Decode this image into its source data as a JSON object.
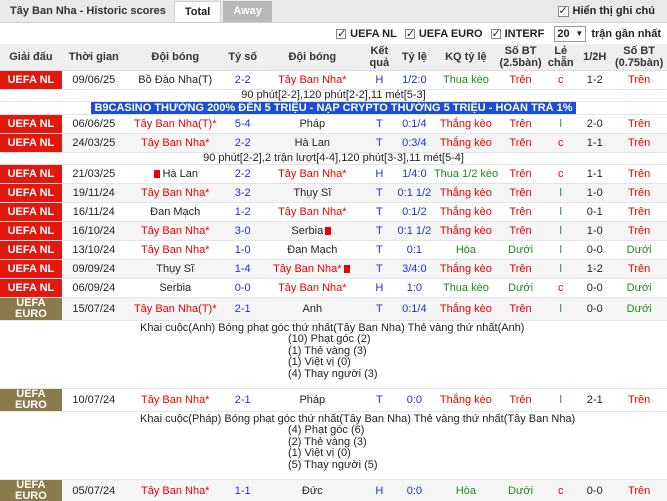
{
  "header": {
    "title": "Tây Ban Nha - Historic scores",
    "tabs": [
      "Total",
      "Away"
    ],
    "show_notes_label": "Hiển thị ghi chú"
  },
  "filters": {
    "items": [
      "UEFA NL",
      "UEFA EURO",
      "INTERF"
    ],
    "count_value": "20",
    "count_suffix": "trận gần nhất"
  },
  "columns": [
    "Giải đấu",
    "Thời gian",
    "Đội bóng",
    "Tỷ số",
    "Đội bóng",
    "Kết quả",
    "Tỷ lệ",
    "KQ tỷ lệ",
    "Số BT (2.5bàn)",
    "Lẻ chẵn",
    "1/2H",
    "Số BT (0.75bàn)"
  ],
  "rows": [
    {
      "league": "UEFA NL",
      "date": "09/06/25",
      "home": "Bồ Đào Nha(T)",
      "score": "2-2",
      "away": "Tây Ban Nha*",
      "res": "H",
      "odds": "1/2:0",
      "kq": "Thua kèo",
      "bt": "Trên",
      "lc": "c",
      "half": "1-2",
      "bt2": "Trên"
    },
    {
      "league": "UEFA NL",
      "date": "06/06/25",
      "home": "Tây Ban Nha(T)*",
      "score": "5-4",
      "away": "Pháp",
      "res": "T",
      "odds": "0:1/4",
      "kq": "Thắng kèo",
      "bt": "Trên",
      "lc": "l",
      "half": "2-0",
      "bt2": "Trên"
    },
    {
      "league": "UEFA NL",
      "date": "24/03/25",
      "home": "Tây Ban Nha*",
      "score": "2-2",
      "away": "Hà Lan",
      "res": "T",
      "odds": "0:3/4",
      "kq": "Thắng kèo",
      "bt": "Trên",
      "lc": "c",
      "half": "1-1",
      "bt2": "Trên"
    },
    {
      "league": "UEFA NL",
      "date": "21/03/25",
      "home": "Hà Lan",
      "score": "2-2",
      "away": "Tây Ban Nha*",
      "res": "H",
      "odds": "1/4:0",
      "kq": "Thua 1/2 kèo",
      "bt": "Trên",
      "lc": "c",
      "half": "1-1",
      "bt2": "Trên"
    },
    {
      "league": "UEFA NL",
      "date": "19/11/24",
      "home": "Tây Ban Nha*",
      "score": "3-2",
      "away": "Thụy Sĩ",
      "res": "T",
      "odds": "0:1 1/2",
      "kq": "Thắng kèo",
      "bt": "Trên",
      "lc": "l",
      "half": "1-0",
      "bt2": "Trên"
    },
    {
      "league": "UEFA NL",
      "date": "16/11/24",
      "home": "Đan Mạch",
      "score": "1-2",
      "away": "Tây Ban Nha*",
      "res": "T",
      "odds": "0:1/2",
      "kq": "Thắng kèo",
      "bt": "Trên",
      "lc": "l",
      "half": "0-1",
      "bt2": "Trên"
    },
    {
      "league": "UEFA NL",
      "date": "16/10/24",
      "home": "Tây Ban Nha*",
      "score": "3-0",
      "away": "Serbia",
      "res": "T",
      "odds": "0:1 1/2",
      "kq": "Thắng kèo",
      "bt": "Trên",
      "lc": "l",
      "half": "1-0",
      "bt2": "Trên"
    },
    {
      "league": "UEFA NL",
      "date": "13/10/24",
      "home": "Tây Ban Nha*",
      "score": "1-0",
      "away": "Đan Mạch",
      "res": "T",
      "odds": "0:1",
      "kq": "Hòa",
      "bt": "Dưới",
      "lc": "l",
      "half": "0-0",
      "bt2": "Dưới"
    },
    {
      "league": "UEFA NL",
      "date": "09/09/24",
      "home": "Thụy Sĩ",
      "score": "1-4",
      "away": "Tây Ban Nha*",
      "res": "T",
      "odds": "3/4:0",
      "kq": "Thắng kèo",
      "bt": "Trên",
      "lc": "l",
      "half": "1-2",
      "bt2": "Trên"
    },
    {
      "league": "UEFA NL",
      "date": "06/09/24",
      "home": "Serbia",
      "score": "0-0",
      "away": "Tây Ban Nha*",
      "res": "H",
      "odds": "1:0",
      "kq": "Thua kèo",
      "bt": "Dưới",
      "lc": "c",
      "half": "0-0",
      "bt2": "Dưới"
    },
    {
      "league": "UEFA EURO",
      "date": "15/07/24",
      "home": "Tây Ban Nha(T)*",
      "score": "2-1",
      "away": "Anh",
      "res": "T",
      "odds": "0:1/4",
      "kq": "Thắng kèo",
      "bt": "Trên",
      "lc": "l",
      "half": "0-0",
      "bt2": "Dưới"
    },
    {
      "league": "UEFA EURO",
      "date": "10/07/24",
      "home": "Tây Ban Nha*",
      "score": "2-1",
      "away": "Pháp",
      "res": "T",
      "odds": "0:0",
      "kq": "Thắng kèo",
      "bt": "Trên",
      "lc": "l",
      "half": "2-1",
      "bt2": "Trên"
    },
    {
      "league": "UEFA EURO",
      "date": "05/07/24",
      "home": "Tây Ban Nha*",
      "score": "1-1",
      "away": "Đức",
      "res": "H",
      "odds": "0:0",
      "kq": "Hòa",
      "bt": "Dưới",
      "lc": "c",
      "half": "0-0",
      "bt2": "Trên"
    }
  ],
  "notes": {
    "n1": "90 phút[2-2],120 phút[2-2],11 mét[5-3]",
    "promo": "B9CASINO THƯỞNG 200% ĐẾN 5 TRIỆU - NẠP CRYPTO THƯỞNG 5 TRIỆU - HOÀN TRẢ 1%",
    "n3": "90 phút[2-2],2 trận lượt[4-4],120 phút[3-3],11 mét[5-4]"
  },
  "stats1": {
    "line1": "Khai cuộc(Anh)  Bóng phạt góc thứ nhất(Tây Ban Nha)  Thẻ vàng thứ nhất(Anh)",
    "lines": [
      "(10) Phạt góc (2)",
      "(1) Thẻ vàng (3)",
      "(1) Việt vị (0)",
      "(4) Thay người (3)"
    ]
  },
  "stats2": {
    "line1": "Khai cuộc(Pháp)  Bóng phạt góc thứ nhất(Tây Ban Nha)  Thẻ vàng thứ nhất(Tây Ban Nha)",
    "lines": [
      "(4) Phạt góc (6)",
      "(2) Thẻ vàng (3)",
      "(1) Việt vị (0)",
      "(5) Thay người (5)"
    ]
  }
}
